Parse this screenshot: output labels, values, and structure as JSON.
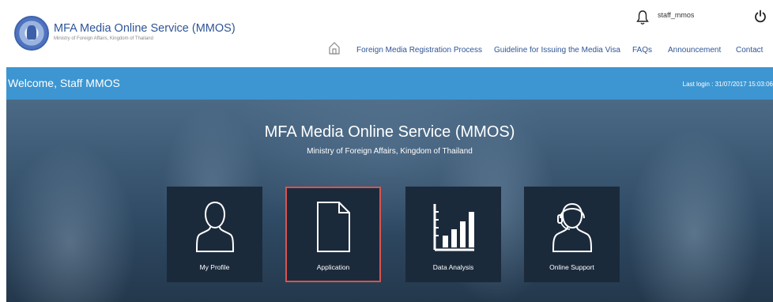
{
  "header": {
    "title": "MFA Media Online Service (MMOS)",
    "subtitle": "Ministry of Foreign Affairs, Kingdom of Thailand",
    "username": "staff_mmos"
  },
  "nav": {
    "items": [
      "Foreign Media Registration Process",
      "Guideline for Issuing the Media Visa",
      "FAQs",
      "Announcement",
      "Contact"
    ]
  },
  "welcome": {
    "text": "Welcome, Staff MMOS",
    "last_login": "Last login : 31/07/2017 15:03:06"
  },
  "hero": {
    "title": "MFA Media Online Service (MMOS)",
    "subtitle": "Ministry of Foreign Affairs, Kingdom of Thailand"
  },
  "tiles": [
    {
      "label": "My Profile",
      "icon": "user-icon"
    },
    {
      "label": "Application",
      "icon": "document-icon",
      "selected": true
    },
    {
      "label": "Data Analysis",
      "icon": "bar-chart-icon"
    },
    {
      "label": "Online Support",
      "icon": "support-agent-icon"
    }
  ],
  "colors": {
    "brand": "#2f5597",
    "welcome_bar": "#3d96d1",
    "tile_bg": "#1b2a3b",
    "selected_border": "#d9534f"
  }
}
